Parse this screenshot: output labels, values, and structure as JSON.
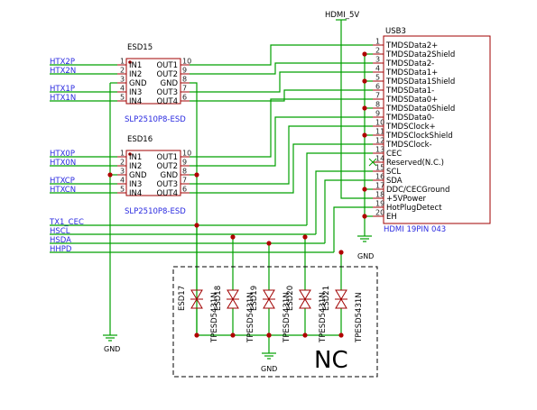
{
  "power": {
    "hdmi_5v": "HDMI_5V",
    "gnd": "GND"
  },
  "esd15": {
    "ref": "ESD15",
    "part": "SLP2510P8-ESD",
    "pins": [
      {
        "num": "1",
        "name": "IN1"
      },
      {
        "num": "2",
        "name": "IN2"
      },
      {
        "num": "3",
        "name": "GND"
      },
      {
        "num": "4",
        "name": "IN3"
      },
      {
        "num": "5",
        "name": "IN4"
      },
      {
        "num": "10",
        "name": "OUT1"
      },
      {
        "num": "9",
        "name": "OUT2"
      },
      {
        "num": "8",
        "name": "GND"
      },
      {
        "num": "7",
        "name": "OUT3"
      },
      {
        "num": "6",
        "name": "OUT4"
      }
    ]
  },
  "esd16": {
    "ref": "ESD16",
    "part": "SLP2510P8-ESD",
    "pins": [
      {
        "num": "1",
        "name": "IN1"
      },
      {
        "num": "2",
        "name": "IN2"
      },
      {
        "num": "3",
        "name": "GND"
      },
      {
        "num": "4",
        "name": "IN3"
      },
      {
        "num": "5",
        "name": "IN4"
      },
      {
        "num": "10",
        "name": "OUT1"
      },
      {
        "num": "9",
        "name": "OUT2"
      },
      {
        "num": "8",
        "name": "GND"
      },
      {
        "num": "7",
        "name": "OUT3"
      },
      {
        "num": "6",
        "name": "OUT4"
      }
    ]
  },
  "usb3": {
    "ref": "USB3",
    "part": "HDMI 19PIN 043",
    "pins": [
      {
        "num": "1",
        "name": "TMDSData2+"
      },
      {
        "num": "2",
        "name": "TMDSData2Shield"
      },
      {
        "num": "3",
        "name": "TMDSData2-"
      },
      {
        "num": "4",
        "name": "TMDSData1+"
      },
      {
        "num": "5",
        "name": "TMDSData1Shield"
      },
      {
        "num": "6",
        "name": "TMDSData1-"
      },
      {
        "num": "7",
        "name": "TMDSData0+"
      },
      {
        "num": "8",
        "name": "TMDSData0Shield"
      },
      {
        "num": "9",
        "name": "TMDSData0-"
      },
      {
        "num": "10",
        "name": "TMDSClock+"
      },
      {
        "num": "11",
        "name": "TMDSClockShield"
      },
      {
        "num": "12",
        "name": "TMDSClock-"
      },
      {
        "num": "13",
        "name": "CEC"
      },
      {
        "num": "14",
        "name": "Reserved(N.C.)"
      },
      {
        "num": "15",
        "name": "SCL"
      },
      {
        "num": "16",
        "name": "SDA"
      },
      {
        "num": "17",
        "name": "DDC/CECGround"
      },
      {
        "num": "18",
        "name": "+5VPower"
      },
      {
        "num": "19",
        "name": "HotPlugDetect"
      },
      {
        "num": "20",
        "name": "EH"
      }
    ]
  },
  "nets": {
    "esd15": [
      "HTX2P",
      "HTX2N",
      "HTX1P",
      "HTX1N"
    ],
    "esd16": [
      "HTX0P",
      "HTX0N",
      "HTXCP",
      "HTXCN"
    ],
    "bus": [
      "TX1_CEC",
      "HSCL",
      "HSDA",
      "HHPD"
    ]
  },
  "tvs": [
    {
      "ref": "ESD17",
      "part": "TPESD5431N"
    },
    {
      "ref": "ESD18",
      "part": "TPESD5431N"
    },
    {
      "ref": "ESD19",
      "part": "TPESD5431N"
    },
    {
      "ref": "ESD20",
      "part": "TPESD5431N"
    },
    {
      "ref": "ESD21",
      "part": "TPESD5431N"
    }
  ],
  "nc_label": "NC",
  "colors": {
    "wire": "#00a000",
    "body": "#a00000",
    "net": "#2a2ae0",
    "junction": "#b00000"
  }
}
